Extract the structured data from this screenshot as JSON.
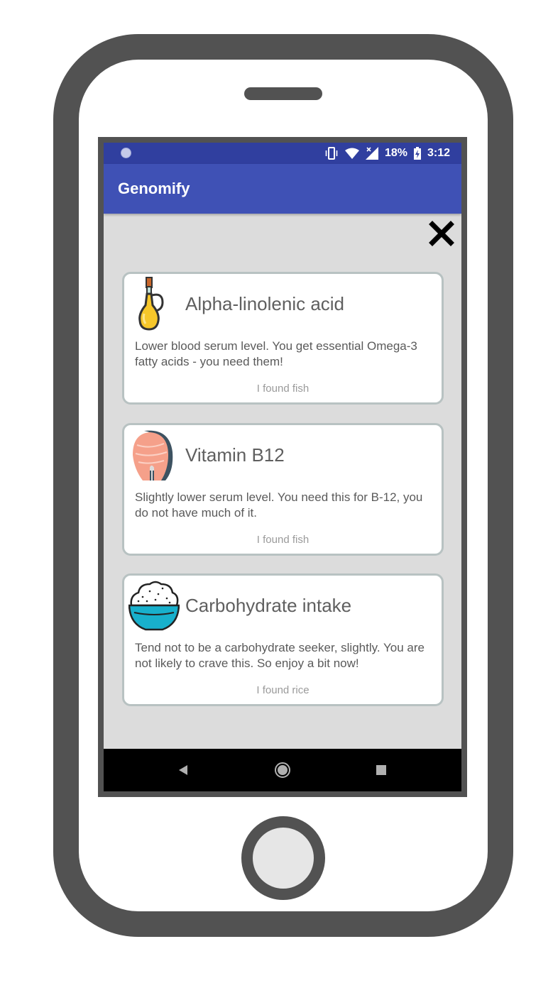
{
  "app": {
    "title": "Genomify"
  },
  "status_bar": {
    "battery": "18%",
    "time": "3:12",
    "icons": [
      "vibrate-icon",
      "wifi-icon",
      "signal-icon",
      "battery-charging-icon"
    ]
  },
  "close_icon": "close-icon",
  "cards": [
    {
      "icon": "oil-bottle-icon",
      "title": "Alpha-linolenic acid",
      "description": "Lower blood serum level. You get essential Omega-3 fatty acids - you need them!",
      "source": "I found fish"
    },
    {
      "icon": "salmon-steak-icon",
      "title": "Vitamin B12",
      "description": "Slightly lower serum level. You need this for B-12, you do not have much of it.",
      "source": "I found fish"
    },
    {
      "icon": "rice-bowl-icon",
      "title": "Carbohydrate intake",
      "description": "Tend not to be a carbohydrate seeker, slightly. You are not likely to crave this. So enjoy a bit now!",
      "source": "I found rice"
    }
  ],
  "nav_bar": [
    "back-icon",
    "home-icon",
    "recents-icon"
  ],
  "colors": {
    "status_bar": "#303f9f",
    "app_bar": "#3f51b5",
    "screen_bg": "#dcdcdc",
    "card_border": "#b8c2c2",
    "device": "#525252"
  }
}
